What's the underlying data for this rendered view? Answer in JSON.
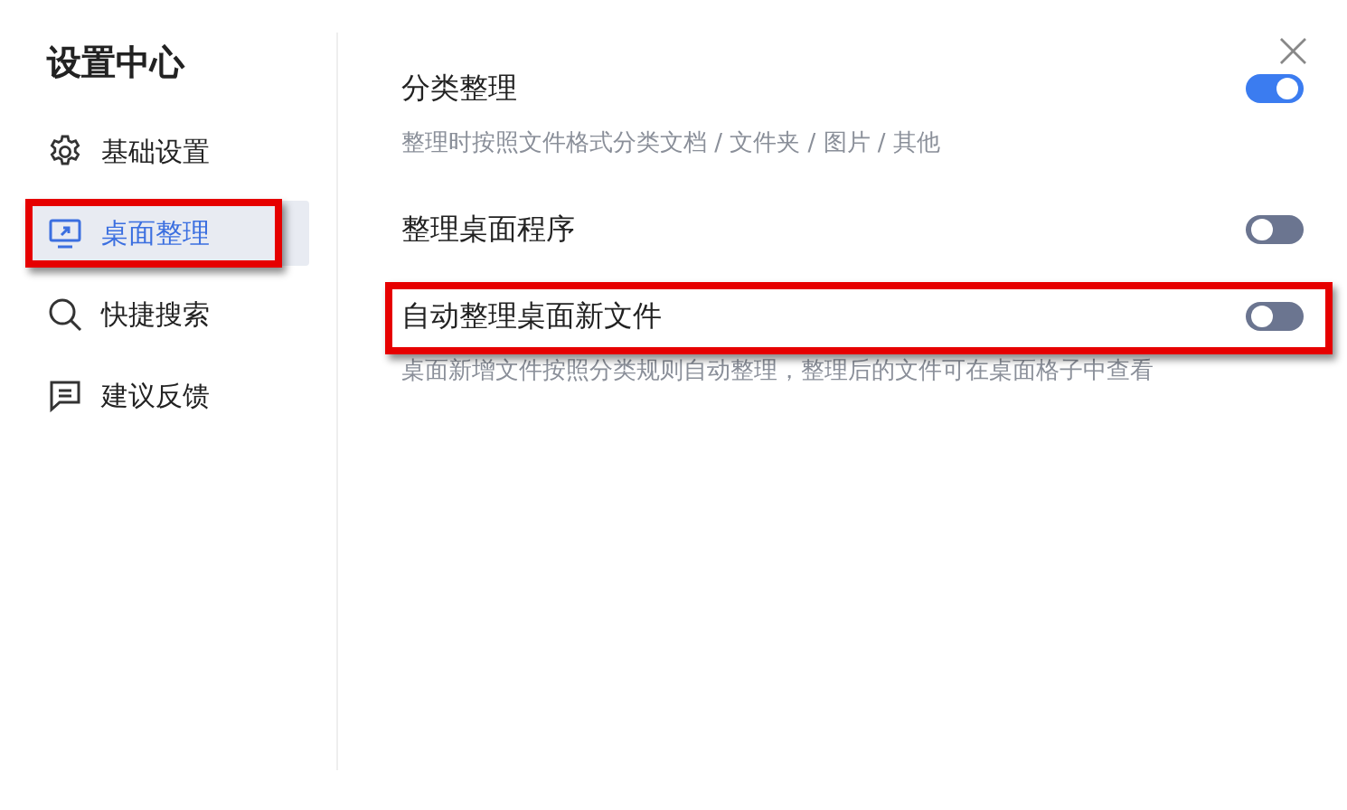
{
  "sidebar": {
    "title": "设置中心",
    "items": [
      {
        "label": "基础设置",
        "selected": false,
        "highlighted": false
      },
      {
        "label": "桌面整理",
        "selected": true,
        "highlighted": true
      },
      {
        "label": "快捷搜索",
        "selected": false,
        "highlighted": false
      },
      {
        "label": "建议反馈",
        "selected": false,
        "highlighted": false
      }
    ]
  },
  "close_button": "×",
  "settings": [
    {
      "title": "分类整理",
      "on": true,
      "highlighted": false,
      "description": "整理时按照文件格式分类文档 / 文件夹 / 图片 / 其他"
    },
    {
      "title": "整理桌面程序",
      "on": false,
      "highlighted": false
    },
    {
      "title": "自动整理桌面新文件",
      "on": false,
      "highlighted": true,
      "description": "桌面新增文件按照分类规则自动整理，整理后的文件可在桌面格子中查看"
    }
  ]
}
